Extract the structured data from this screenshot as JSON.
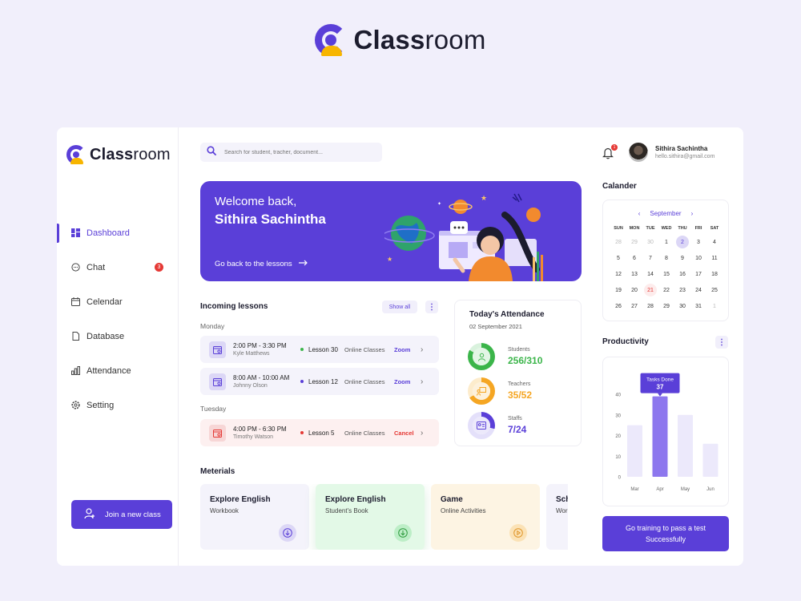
{
  "brand": {
    "name_bold": "Class",
    "name_light": "room"
  },
  "sidebar": {
    "items": [
      {
        "label": "Dashboard",
        "icon": "grid-icon",
        "active": true
      },
      {
        "label": "Chat",
        "icon": "chat-icon",
        "badge": "3"
      },
      {
        "label": "Celendar",
        "icon": "calendar-icon"
      },
      {
        "label": "Database",
        "icon": "file-icon"
      },
      {
        "label": "Attendance",
        "icon": "bar-chart-icon"
      },
      {
        "label": "Setting",
        "icon": "gear-icon"
      }
    ],
    "join_button": "Join a new class"
  },
  "header": {
    "search_placeholder": "Search for student, tracher, document...",
    "notification_count": "1",
    "user_name": "Sithira Sachintha",
    "user_email": "hello.sithira@gmail.com"
  },
  "banner": {
    "greeting": "Welcome back,",
    "name": "Sithira Sachintha",
    "link": "Go back to the lessons"
  },
  "lessons": {
    "title": "Incoming lessons",
    "show_all": "Show all",
    "days": [
      "Monday",
      "Tuesday"
    ],
    "items": [
      {
        "time": "2:00 PM - 3:30 PM",
        "person": "Kyle Matthews",
        "lesson": "Lesson 30",
        "type": "Online Classes",
        "action": "Zoom",
        "dot": "#3bb54a",
        "action_color": "#5a3fd8"
      },
      {
        "time": "8:00 AM - 10:00 AM",
        "person": "Johnny Olson",
        "lesson": "Lesson 12",
        "type": "Online Classes",
        "action": "Zoom",
        "dot": "#5a3fd8",
        "action_color": "#5a3fd8"
      },
      {
        "time": "4:00 PM - 6:30 PM",
        "person": "Timothy Watson",
        "lesson": "Lesson 5",
        "type": "Online Classes",
        "action": "Cancel",
        "dot": "#e53935",
        "action_color": "#e53935"
      }
    ]
  },
  "attendance": {
    "title": "Today's Attendance",
    "date": "02  September 2021",
    "rows": [
      {
        "label": "Students",
        "value": "256/310",
        "color": "#3bb54a",
        "fraction": 0.83
      },
      {
        "label": "Teachers",
        "value": "35/52",
        "color": "#f5a623",
        "fraction": 0.67
      },
      {
        "label": "Staffs",
        "value": "7/24",
        "color": "#5a3fd8",
        "fraction": 0.29
      }
    ]
  },
  "materials": {
    "title": "Meterials",
    "items": [
      {
        "title": "Explore English",
        "subtitle": "Workbook",
        "bg": "#f4f3fb",
        "btn": "#dcd7f6",
        "fg": "#5a3fd8",
        "icon": "download-icon"
      },
      {
        "title": "Explore English",
        "subtitle": "Student's Book",
        "bg": "#e3f9e7",
        "btn": "#bdeec7",
        "fg": "#2e9b3e",
        "icon": "download-icon"
      },
      {
        "title": "Game",
        "subtitle": "Online Activities",
        "bg": "#fdf4e3",
        "btn": "#fbe2b6",
        "fg": "#e0962a",
        "icon": "play-icon"
      },
      {
        "title": "Sch",
        "subtitle": "Wor",
        "bg": "#f4f3fb",
        "btn": "#dcd7f6",
        "fg": "#5a3fd8",
        "icon": "download-icon"
      }
    ]
  },
  "calendar": {
    "title": "Calander",
    "month": "September",
    "weekdays": [
      "SUN",
      "MON",
      "TUE",
      "WED",
      "THU",
      "FRI",
      "SAT"
    ],
    "days": [
      {
        "d": "28",
        "m": true
      },
      {
        "d": "29",
        "m": true
      },
      {
        "d": "30",
        "m": true
      },
      {
        "d": "1"
      },
      {
        "d": "2",
        "sel": true
      },
      {
        "d": "3"
      },
      {
        "d": "4"
      },
      {
        "d": "5"
      },
      {
        "d": "6"
      },
      {
        "d": "7"
      },
      {
        "d": "8"
      },
      {
        "d": "9"
      },
      {
        "d": "10"
      },
      {
        "d": "11"
      },
      {
        "d": "12"
      },
      {
        "d": "13"
      },
      {
        "d": "14"
      },
      {
        "d": "15"
      },
      {
        "d": "16"
      },
      {
        "d": "17"
      },
      {
        "d": "18"
      },
      {
        "d": "19"
      },
      {
        "d": "20"
      },
      {
        "d": "21",
        "today": true
      },
      {
        "d": "22"
      },
      {
        "d": "23"
      },
      {
        "d": "24"
      },
      {
        "d": "25"
      },
      {
        "d": "26"
      },
      {
        "d": "27"
      },
      {
        "d": "28"
      },
      {
        "d": "29"
      },
      {
        "d": "30"
      },
      {
        "d": "31"
      },
      {
        "d": "1",
        "m": true
      }
    ]
  },
  "productivity": {
    "title": "Productivity",
    "tooltip_label": "Tasks Done",
    "tooltip_value": "37"
  },
  "chart_data": {
    "type": "bar",
    "categories": [
      "Mar",
      "Apr",
      "May",
      "Jun"
    ],
    "values": [
      25,
      39,
      30,
      16
    ],
    "ylim": [
      0,
      40
    ],
    "yticks": [
      0,
      10,
      20,
      30,
      40
    ],
    "highlight_index": 1,
    "grid": false
  },
  "train_button": "Go training to pass a test Successfully",
  "colors": {
    "accent": "#5a3fd8",
    "secondary": "#f7b500"
  }
}
